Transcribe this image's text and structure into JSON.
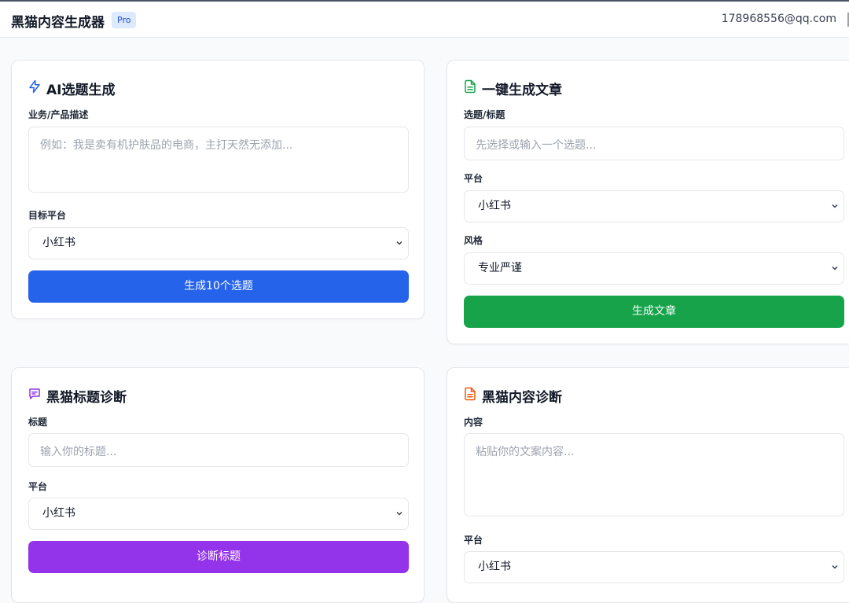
{
  "header": {
    "brand": "黑猫内容生成器",
    "badge": "Pro",
    "email": "178968556@qq.com"
  },
  "cards": {
    "topic": {
      "title": "AI选题生成",
      "desc_label": "业务/产品描述",
      "desc_placeholder": "例如：我是卖有机护肤品的电商，主打天然无添加...",
      "platform_label": "目标平台",
      "platform_value": "小红书",
      "button": "生成10个选题",
      "color": "#2563eb"
    },
    "article": {
      "title": "一键生成文章",
      "topic_label": "选题/标题",
      "topic_placeholder": "先选择或输入一个选题...",
      "platform_label": "平台",
      "platform_value": "小红书",
      "style_label": "风格",
      "style_value": "专业严谨",
      "button": "生成文章",
      "color": "#16a34a"
    },
    "title_diag": {
      "title": "黑猫标题诊断",
      "title_label": "标题",
      "title_placeholder": "输入你的标题...",
      "platform_label": "平台",
      "platform_value": "小红书",
      "button": "诊断标题",
      "color": "#9333ea"
    },
    "content_diag": {
      "title": "黑猫内容诊断",
      "content_label": "内容",
      "content_placeholder": "粘贴你的文案内容...",
      "platform_label": "平台",
      "platform_value": "小红书",
      "color": "#ea580c"
    }
  }
}
